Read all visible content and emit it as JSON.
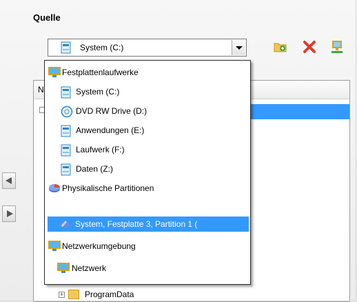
{
  "section": {
    "title": "Quelle"
  },
  "source_combo": {
    "selected": "System (C:)",
    "icon": "drive-icon"
  },
  "toolbar": {
    "add": {
      "icon": "folder-add-icon"
    },
    "delete": {
      "icon": "delete-x-icon"
    },
    "network": {
      "icon": "network-drive-icon"
    }
  },
  "tree": {
    "header": "N",
    "bottom_item": {
      "expander": "+",
      "label": "ProgramData",
      "icon": "folder-icon"
    }
  },
  "nav": {
    "left": "arrow-left-icon",
    "right": "arrow-right-icon"
  },
  "dropdown": {
    "items": [
      {
        "label": "Festplattenlaufwerke",
        "icon": "computer-icon",
        "level": 0
      },
      {
        "label": "System (C:)",
        "icon": "drive-icon",
        "level": 1
      },
      {
        "label": "DVD RW Drive (D:)",
        "icon": "dvd-icon",
        "level": 1
      },
      {
        "label": "Anwendungen (E:)",
        "icon": "drive-icon",
        "level": 1
      },
      {
        "label": "Laufwerk (F:)",
        "icon": "drive-icon",
        "level": 1
      },
      {
        "label": "Daten (Z:)",
        "icon": "drive-icon",
        "level": 1
      },
      {
        "label": "Physikalische Partitionen",
        "icon": "partition-icon",
        "level": 0
      },
      {
        "label": "System, Festplatte 3, Partition 1 (",
        "icon": "partition-item-icon",
        "level": 1,
        "selected": true
      },
      {
        "label": "Netzwerkumgebung",
        "icon": "computer-icon",
        "level": 0
      },
      {
        "label": "Netzwerk",
        "icon": "network-icon",
        "level": 1
      }
    ]
  },
  "colors": {
    "selection": "#3399ff",
    "accent": "#4a90d9"
  }
}
